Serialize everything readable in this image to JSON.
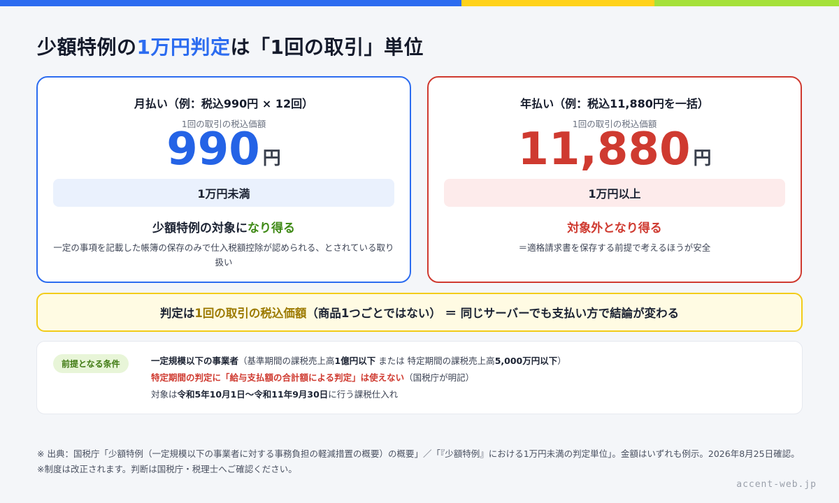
{
  "colors": {
    "blue": "#2c6cf0",
    "yellow": "#ffd21a",
    "green": "#a5e13a",
    "red": "#cf3a30"
  },
  "title": {
    "prefix": "少額特例の",
    "highlight": "1万円判定",
    "suffix": "は「1回の取引」単位"
  },
  "monthly": {
    "heading": "月払い（例：税込990円 × 12回）",
    "sublabel": "1回の取引の税込価額",
    "amount": "990",
    "unit": "円",
    "badge": "1万円未満",
    "verdict_prefix": "少額特例の対象に",
    "verdict_highlight": "なり得る",
    "note": "一定の事項を記載した帳簿の保存のみで仕入税額控除が認められる、とされている取り扱い"
  },
  "annual": {
    "heading": "年払い（例：税込11,880円を一括）",
    "sublabel": "1回の取引の税込価額",
    "amount": "11,880",
    "unit": "円",
    "badge": "1万円以上",
    "verdict": "対象外となり得る",
    "note": "＝適格請求書を保存する前提で考えるほうが安全"
  },
  "banner": {
    "prefix": "判定は",
    "highlight": "1回の取引の税込価額",
    "suffix": "（商品1つごとではない） ＝ 同じサーバーでも支払い方で結論が変わる"
  },
  "conditions": {
    "tag": "前提となる条件",
    "line1": {
      "bold1": "一定規模以下の事業者",
      "t1": "（基準期間の課税売上高",
      "bold2": "1億円以下",
      "t2": " または 特定期間の課税売上高",
      "bold3": "5,000万円以下",
      "t3": "）"
    },
    "line2": {
      "red": "特定期間の判定に「給与支払額の合計額による判定」は使えない",
      "rest": "（国税庁が明記）"
    },
    "line3": {
      "t1": "対象は",
      "bold": "令和5年10月1日〜令和11年9月30日",
      "t2": "に行う課税仕入れ"
    }
  },
  "source": "※ 出典：国税庁「少額特例（一定規模以下の事業者に対する事務負担の軽減措置の概要）の概要」／「『少額特例』における1万円未満の判定単位」。金額はいずれも例示。2026年8月25日確認。※制度は改正されます。判断は国税庁・税理士へご確認ください。",
  "brand": "accent-web.jp"
}
